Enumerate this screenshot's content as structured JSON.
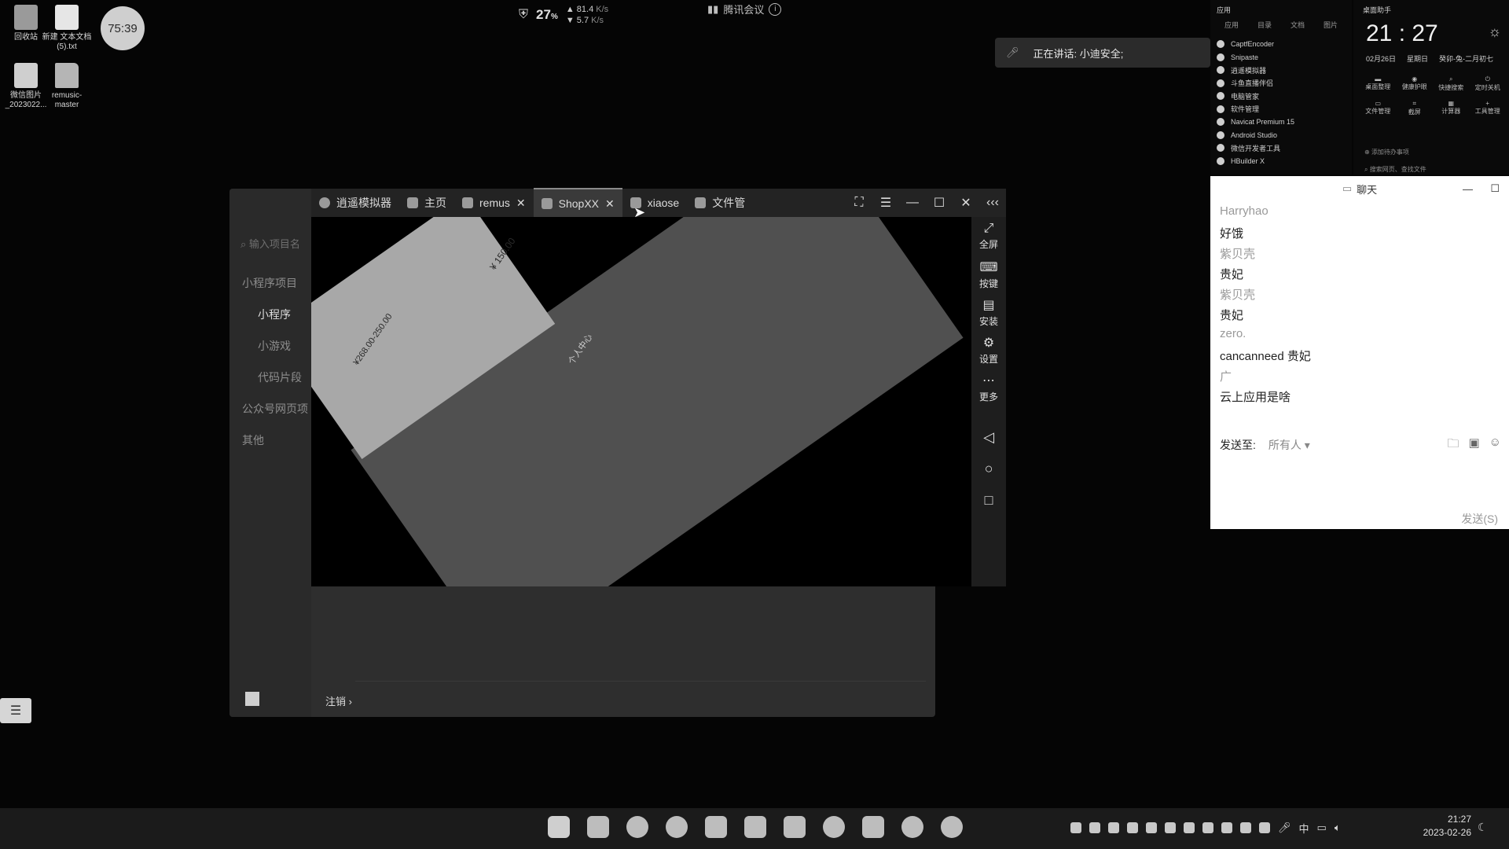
{
  "desktop": {
    "icons": [
      {
        "label": "回收站",
        "icon": "recycle-bin-icon"
      },
      {
        "label": "新建 文本文档 (5).txt",
        "icon": "text-file-icon"
      },
      {
        "label": "微信图片_2023022...",
        "icon": "image-file-icon"
      },
      {
        "label": "remusic-master",
        "icon": "folder-icon"
      }
    ],
    "timer": "75:39"
  },
  "status_widget": {
    "cpu": "27",
    "cpu_unit": "%",
    "upload": "81.4",
    "download": "5.7",
    "speed_unit": "K/s"
  },
  "meeting": {
    "title": "腾讯会议",
    "speaking": "正在讲话: 小迪安全;"
  },
  "app_panel": {
    "header": "应用",
    "tabs": [
      "应用",
      "目录",
      "文档",
      "图片"
    ],
    "items": [
      "CaptfEncoder",
      "Snipaste",
      "逍遥模拟器",
      "斗鱼直播伴侣",
      "电脑管家",
      "软件管理",
      "Navicat Premium 15",
      "Android Studio",
      "微信开发者工具",
      "HBuilder X"
    ]
  },
  "assistant": {
    "title": "桌面助手",
    "time": "21 : 27",
    "date": "02月26日",
    "weekday": "星期日",
    "lunar": "癸卯-兔-二月初七",
    "tools": [
      "桌面整理",
      "健康护眼",
      "快捷搜索",
      "定时关机",
      "文件管理",
      "截屏",
      "计算器",
      "工具管理"
    ],
    "todo": "添加待办事项",
    "search": "搜索网页、查找文件"
  },
  "emulator": {
    "sidebar": {
      "search_placeholder": "输入项目名",
      "items": [
        "小程序项目",
        "小程序",
        "小游戏",
        "代码片段",
        "公众号网页项",
        "其他"
      ],
      "logout": "注销 ›"
    },
    "tabs": [
      {
        "label": "逍遥模拟器",
        "icon": "memu-logo-icon"
      },
      {
        "label": "主页",
        "icon": "home-icon"
      },
      {
        "label": "remus",
        "icon": "app-icon"
      },
      {
        "label": "ShopXX",
        "icon": "shopxx-icon"
      },
      {
        "label": "xiaose",
        "icon": "app-icon"
      },
      {
        "label": "文件管",
        "icon": "file-manager-icon"
      }
    ],
    "active_tab": "ShopXX",
    "toolbar": [
      {
        "label": "全屏",
        "icon": "fullscreen-icon"
      },
      {
        "label": "按键",
        "icon": "keyboard-icon"
      },
      {
        "label": "安装",
        "icon": "apk-icon"
      },
      {
        "label": "设置",
        "icon": "gear-icon"
      },
      {
        "label": "更多",
        "icon": "more-icon"
      }
    ],
    "screen_texts": [
      "¥ 150.00",
      "¥268.00-250.00",
      "个人中心"
    ]
  },
  "chat": {
    "title": "聊天",
    "messages": [
      {
        "name": "Harryhao",
        "text": "好饿"
      },
      {
        "name": "紫贝壳",
        "text": "贵妃"
      },
      {
        "name": "紫贝壳",
        "text": "贵妃"
      },
      {
        "name": "zero.",
        "text": "cancanneed  贵妃"
      },
      {
        "name": "广",
        "text": "云上应用是啥"
      }
    ],
    "send_to_label": "发送至:",
    "send_to_value": "所有人",
    "send_button": "发送(S)"
  },
  "taskbar": {
    "apps": [
      "start-icon",
      "file-explorer-icon",
      "edge-icon",
      "chrome-icon",
      "store-icon",
      "photos-icon",
      "tool-icon",
      "memu-icon",
      "app-icon",
      "app-icon",
      "wechat-icon"
    ],
    "ime": "中",
    "time": "21:27",
    "date": "2023-02-26"
  }
}
